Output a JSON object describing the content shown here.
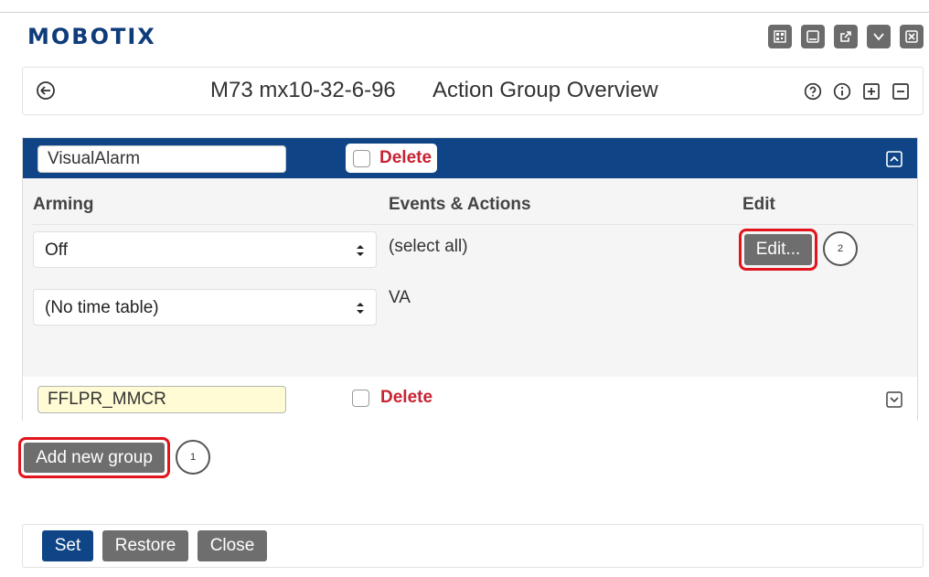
{
  "brand": {
    "logo_text": "MOBOTIX"
  },
  "window_controls": [
    "qr-code-icon",
    "minimize-icon",
    "external-link-icon",
    "dropdown-icon",
    "close-window-icon"
  ],
  "header": {
    "device": "M73 mx10-32-6-96",
    "title": "Action Group Overview",
    "icons": [
      "help-icon",
      "info-icon",
      "expand-all-icon",
      "collapse-all-icon"
    ]
  },
  "groups": [
    {
      "name": "VisualAlarm",
      "delete_label": "Delete",
      "columns": {
        "arming": "Arming",
        "events_actions": "Events & Actions",
        "edit": "Edit"
      },
      "arming_value": "Off",
      "time_table_value": "(No time table)",
      "events_actions": [
        "(select all)",
        "VA"
      ],
      "edit_label": "Edit...",
      "edit_callout": "2",
      "expanded": true
    },
    {
      "name": "FFLPR_MMCR",
      "delete_label": "Delete",
      "expanded": false
    }
  ],
  "add_group": {
    "label": "Add new group",
    "callout": "1"
  },
  "footer": {
    "set": "Set",
    "restore": "Restore",
    "close": "Close"
  },
  "colors": {
    "brand_blue": "#0f4586",
    "button_gray": "#6e6e6e",
    "delete_red": "#c82333",
    "highlight_red": "#e2141c",
    "active_input_bg": "#fffbd5"
  }
}
